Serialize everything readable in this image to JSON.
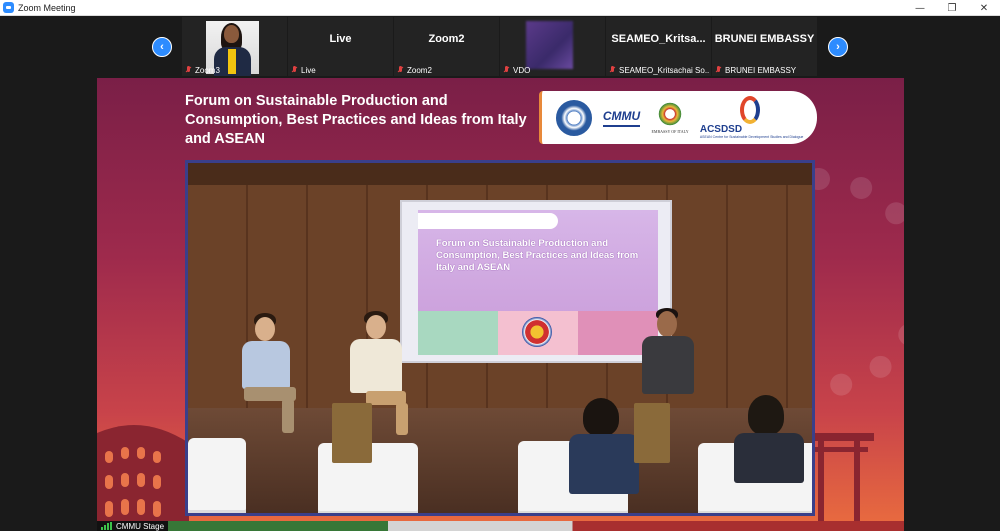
{
  "window": {
    "title": "Zoom Meeting",
    "controls": {
      "minimize": "—",
      "restore": "❐",
      "close": "✕"
    }
  },
  "strip": {
    "prev_icon": "‹",
    "next_icon": "›",
    "participants": [
      {
        "name": "",
        "label": "Zoom3",
        "tile": "photo"
      },
      {
        "name": "Live",
        "label": "Live",
        "tile": "text"
      },
      {
        "name": "Zoom2",
        "label": "Zoom2",
        "tile": "text"
      },
      {
        "name": "",
        "label": "VDO",
        "tile": "blur"
      },
      {
        "name": "SEAMEO_Kritsa...",
        "label": "SEAMEO_Kritsachai So...",
        "tile": "text"
      },
      {
        "name": "BRUNEI EMBASSY",
        "label": "BRUNEI EMBASSY",
        "tile": "text"
      }
    ]
  },
  "stage": {
    "title": "Forum on Sustainable Production and Consumption, Best Practices and Ideas from Italy and ASEAN",
    "logos": {
      "cmmu": "CMMU",
      "embassy": "EMBASSY OF ITALY",
      "acsdsd": "ACSDSD",
      "acsdsd_sub": "ASEAN Centre for Sustainable Development Studies and Dialogue"
    },
    "slide_title": "Forum on Sustainable Production and Consumption, Best Practices and Ideas from Italy and ASEAN",
    "speaker_label": "CMMU Stage"
  },
  "colors": {
    "zoom_blue": "#2d8cff",
    "stage_top": "#7a1f47",
    "stage_bottom": "#e86a3f",
    "muted_mic": "#e04141"
  }
}
